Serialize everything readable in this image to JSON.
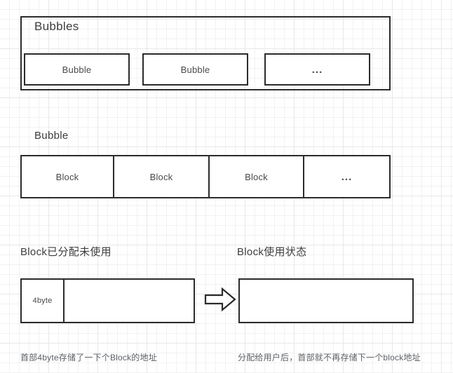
{
  "diagram": {
    "bubbles_group": {
      "title": "Bubbles",
      "cells": [
        {
          "label": "Bubble"
        },
        {
          "label": "Bubble"
        },
        {
          "label": "..."
        }
      ]
    },
    "bubble_section": {
      "title": "Bubble",
      "cells": [
        {
          "label": "Block"
        },
        {
          "label": "Block"
        },
        {
          "label": "Block"
        },
        {
          "label": "..."
        }
      ]
    },
    "block_states": {
      "left": {
        "title": "Block已分配未使用",
        "header_cell": "4byte",
        "body_cell": "",
        "caption": "首部4byte存储了一下个Block的地址"
      },
      "arrow": {
        "name": "right-block-arrow"
      },
      "right": {
        "title": "Block使用状态",
        "body_cell": "",
        "caption": "分配给用户后，首部就不再存储下一个block地址"
      }
    }
  },
  "colors": {
    "stroke": "#2b2b2b",
    "text": "#3d3d3d",
    "caption": "#5c6066",
    "grid_minor": "#f2f2f2",
    "grid_major": "#e8e8e8",
    "background": "#ffffff"
  }
}
